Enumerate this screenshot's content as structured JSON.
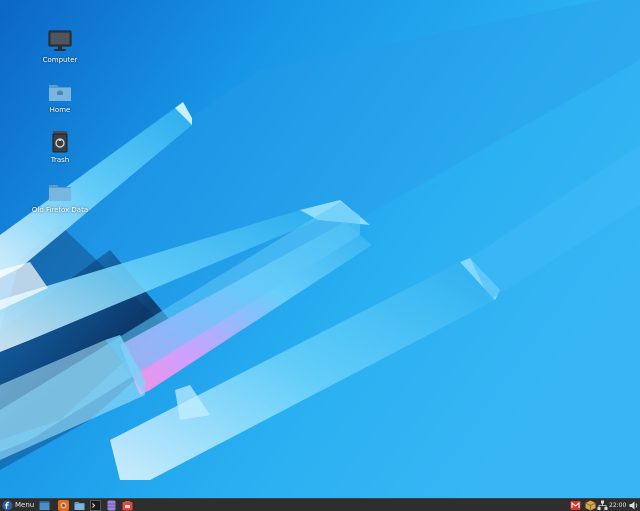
{
  "desktop": {
    "icons": [
      {
        "label": "Computer",
        "icon": "monitor-icon"
      },
      {
        "label": "Home",
        "icon": "home-folder-icon"
      },
      {
        "label": "Trash",
        "icon": "trash-icon"
      },
      {
        "label": "Old Firefox Data",
        "icon": "folder-icon"
      }
    ]
  },
  "taskbar": {
    "menu_label": "Menu",
    "launchers": [
      {
        "name": "show-desktop-icon"
      },
      {
        "name": "firefox-icon"
      },
      {
        "name": "file-manager-icon"
      },
      {
        "name": "terminal-icon"
      },
      {
        "name": "database-icon"
      },
      {
        "name": "software-store-icon"
      }
    ],
    "tray": [
      {
        "name": "mail-icon"
      },
      {
        "name": "updates-icon"
      },
      {
        "name": "network-icon"
      }
    ],
    "clock": "22:00",
    "volume_icon": "volume-icon"
  },
  "colors": {
    "wallpaper_base": "#2ab0f2",
    "wallpaper_dark": "#0c66c6",
    "taskbar_bg": "#2e2e2e"
  }
}
